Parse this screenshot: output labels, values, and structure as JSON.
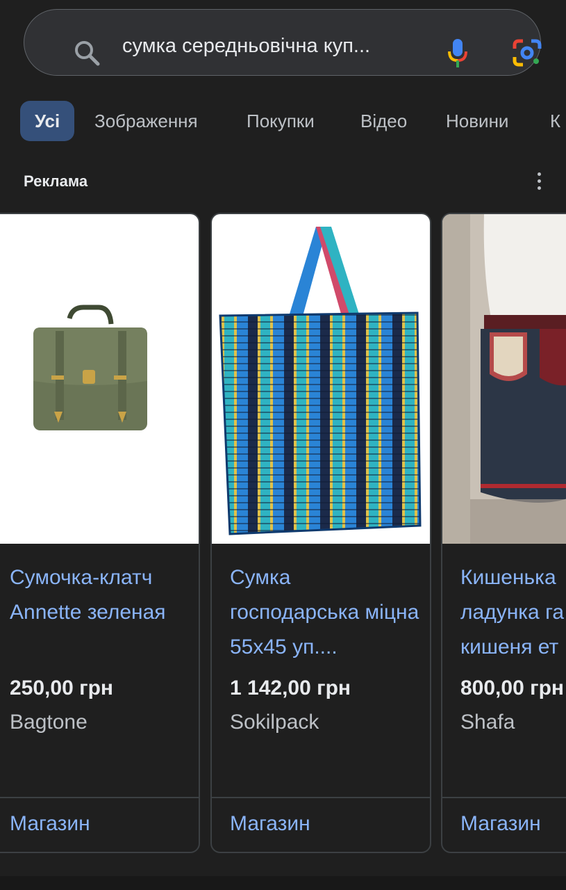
{
  "search": {
    "query": "сумка середньовічна куп..."
  },
  "tabs": [
    {
      "label": "Усі",
      "active": true
    },
    {
      "label": "Зображення"
    },
    {
      "label": "Покупки"
    },
    {
      "label": "Відео"
    },
    {
      "label": "Новини"
    },
    {
      "label": "К"
    }
  ],
  "ads": {
    "label": "Реклама",
    "products": [
      {
        "title": "Сумочка-клатч Annette зеленая",
        "price": "250,00 грн",
        "seller": "Bagtone",
        "shop_label": "Магазин",
        "image": "green-satchel-bag"
      },
      {
        "title": "Сумка господарська міцна 55х45 уп....",
        "price": "1 142,00 грн",
        "seller": "Sokilpack",
        "shop_label": "Магазин",
        "image": "striped-plastic-shopping-bag"
      },
      {
        "title": "Кишенька ладунка га кишеня ет",
        "price": "800,00 грн",
        "seller": "Shafa",
        "shop_label": "Магазин",
        "image": "embroidered-belt-pouch-on-costume"
      }
    ]
  },
  "colors": {
    "background": "#1f1f1f",
    "link": "#8ab4f8",
    "active_tab": "#35507a"
  }
}
